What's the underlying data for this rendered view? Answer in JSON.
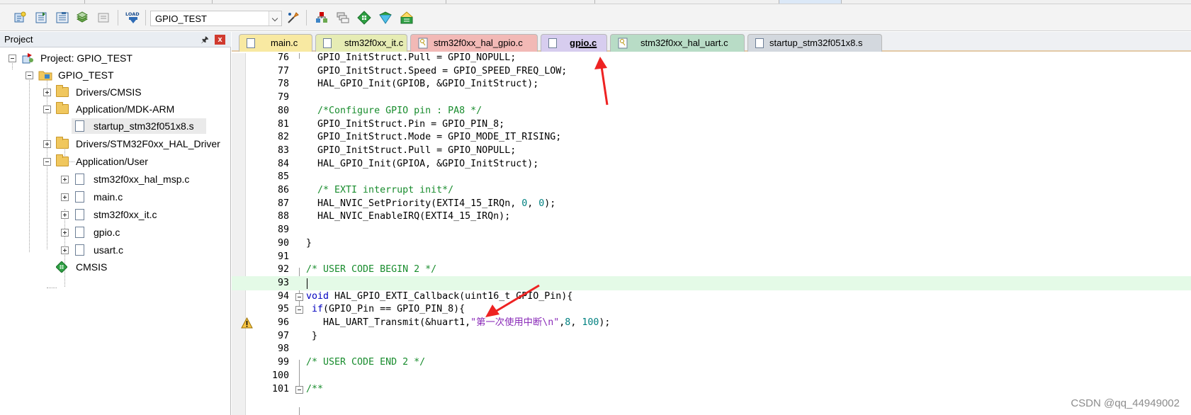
{
  "toolbar": {
    "target": "GPIO_TEST",
    "load_label": "LOAD"
  },
  "project": {
    "title": "Project",
    "pin_glyph": " ⫯",
    "close_glyph": "x",
    "items": [
      {
        "label": "Project: GPIO_TEST"
      },
      {
        "label": "GPIO_TEST"
      },
      {
        "label": "Drivers/CMSIS"
      },
      {
        "label": "Application/MDK-ARM"
      },
      {
        "label": "startup_stm32f051x8.s"
      },
      {
        "label": "Drivers/STM32F0xx_HAL_Driver"
      },
      {
        "label": "Application/User"
      },
      {
        "label": "stm32f0xx_hal_msp.c"
      },
      {
        "label": "main.c"
      },
      {
        "label": "stm32f0xx_it.c"
      },
      {
        "label": "gpio.c"
      },
      {
        "label": "usart.c"
      },
      {
        "label": "CMSIS"
      }
    ]
  },
  "tabs": [
    {
      "label": "main.c",
      "color": "#f8e9a2"
    },
    {
      "label": "stm32f0xx_it.c",
      "color": "#e6ecb4"
    },
    {
      "label": "stm32f0xx_hal_gpio.c",
      "color": "#f2b9b6"
    },
    {
      "label": "gpio.c",
      "color": "#d7cdef"
    },
    {
      "label": "stm32f0xx_hal_uart.c",
      "color": "#b8dcc6"
    },
    {
      "label": "startup_stm32f051x8.s",
      "color": "#d3d8de"
    }
  ],
  "code": {
    "lines": [
      {
        "n": "76",
        "t": "  GPIO_InitStruct.Pull = GPIO_NOPULL;"
      },
      {
        "n": "77",
        "t": "  GPIO_InitStruct.Speed = GPIO_SPEED_FREQ_LOW;"
      },
      {
        "n": "78",
        "t": "  HAL_GPIO_Init(GPIOB, &GPIO_InitStruct);"
      },
      {
        "n": "79",
        "t": ""
      },
      {
        "n": "80",
        "t": "  /*Configure GPIO pin : PA8 */"
      },
      {
        "n": "81",
        "t": "  GPIO_InitStruct.Pin = GPIO_PIN_8;"
      },
      {
        "n": "82",
        "t": "  GPIO_InitStruct.Mode = GPIO_MODE_IT_RISING;"
      },
      {
        "n": "83",
        "t": "  GPIO_InitStruct.Pull = GPIO_NOPULL;"
      },
      {
        "n": "84",
        "t": "  HAL_GPIO_Init(GPIOA, &GPIO_InitStruct);"
      },
      {
        "n": "85",
        "t": ""
      },
      {
        "n": "86",
        "t": "  /* EXTI interrupt init*/"
      },
      {
        "n": "87",
        "t_a": "  HAL_NVIC_SetPriority(EXTI4_15_IRQn, ",
        "t_b": "0",
        "t_c": ", ",
        "t_d": "0",
        "t_e": ");"
      },
      {
        "n": "88",
        "t": "  HAL_NVIC_EnableIRQ(EXTI4_15_IRQn);"
      },
      {
        "n": "89",
        "t": ""
      },
      {
        "n": "90",
        "t": "}"
      },
      {
        "n": "91",
        "t": ""
      },
      {
        "n": "92",
        "t": "/* USER CODE BEGIN 2 */"
      },
      {
        "n": "93",
        "t": ""
      },
      {
        "n": "94",
        "kw": "void",
        "t": " HAL_GPIO_EXTI_Callback(uint16_t GPIO_Pin){"
      },
      {
        "n": "95",
        "kw": " if",
        "t": "(GPIO_Pin == GPIO_PIN_8){"
      },
      {
        "n": "96",
        "t_a": "   HAL_UART_Transmit(&huart1,",
        "str": "\"第一次使用中断\\n\"",
        "t_b": ",",
        "t_c": "8",
        "t_d": ", ",
        "t_e": "100",
        "t_f": ");"
      },
      {
        "n": "97",
        "t": " }"
      },
      {
        "n": "98",
        "t": ""
      },
      {
        "n": "99",
        "t": "/* USER CODE END 2 */"
      },
      {
        "n": "100",
        "t": ""
      },
      {
        "n": "101",
        "t": "/**"
      }
    ]
  },
  "watermark": "CSDN @qq_44949002"
}
